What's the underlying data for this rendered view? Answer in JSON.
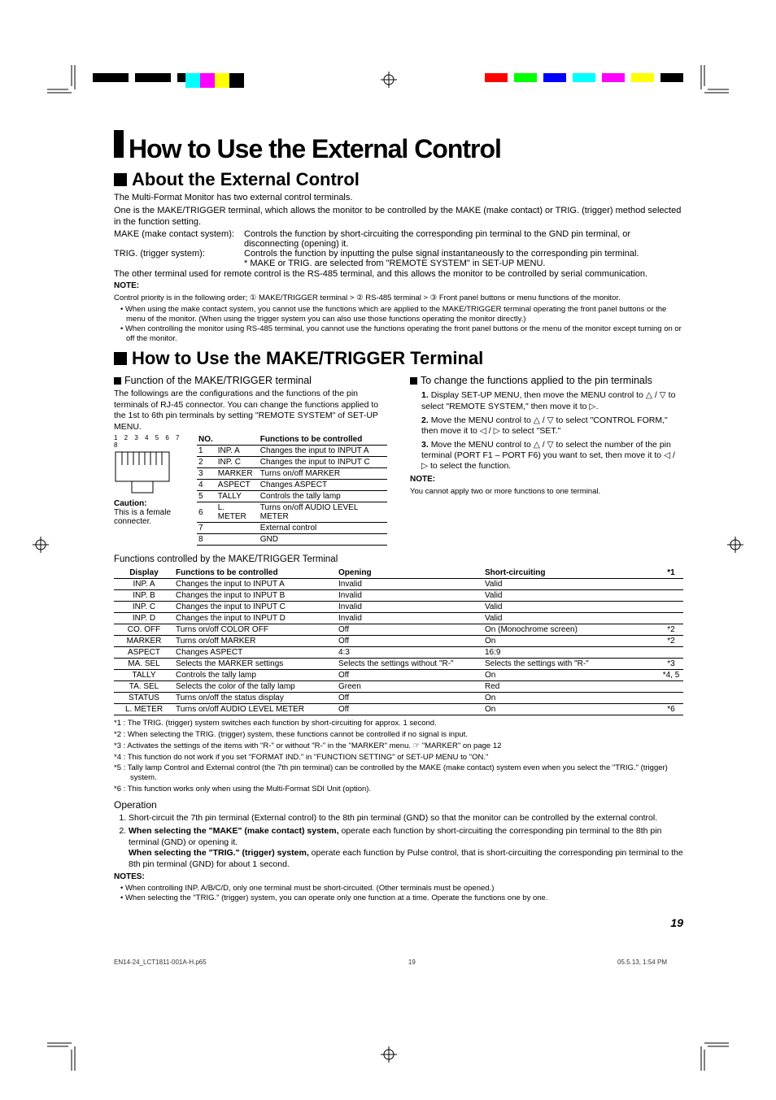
{
  "title": "How to Use the External Control",
  "about": {
    "heading": "About the External Control",
    "p1": "The Multi-Format Monitor has two external control terminals.",
    "p2": "One is the MAKE/TRIGGER terminal, which allows the monitor to be controlled by the MAKE (make contact) or TRIG. (trigger) method selected in the function setting.",
    "make_term": "MAKE (make contact system):",
    "make_desc": "Controls the function by short-circuiting the corresponding pin terminal to the GND pin terminal, or disconnecting (opening) it.",
    "trig_term": "TRIG. (trigger system):",
    "trig_desc1": "Controls the function by inputting the pulse signal instantaneously to the corresponding pin terminal.",
    "trig_desc2": "* MAKE or TRIG. are selected from \"REMOTE SYSTEM\" in SET-UP MENU.",
    "other_term": "The other terminal used for remote control is the RS-485 terminal, and this allows the monitor to be controlled by serial communication.",
    "note_label": "NOTE:",
    "note_intro": "Control priority is in the following order; ① MAKE/TRIGGER terminal > ② RS-485 terminal > ③ Front panel buttons or menu functions of the monitor.",
    "note_b1": "When using the make contact system, you cannot use the functions which are applied to the MAKE/TRIGGER terminal operating the front panel buttons or the menu of the monitor. (When using the trigger system you can also use those functions operating the monitor directly.)",
    "note_b2": "When controlling the monitor using RS-485 terminal, you cannot use the functions operating the front panel buttons or the menu of the monitor except turning on or off the monitor."
  },
  "maketrig": {
    "heading": "How to Use the MAKE/TRIGGER Terminal",
    "sub_left": "Function of the MAKE/TRIGGER terminal",
    "left_p": "The followings are the configurations and the functions of the pin terminals of RJ-45 connector. You can change the functions applied to the 1st to 6th pin terminals by setting \"REMOTE SYSTEM\" of SET-UP MENU.",
    "pin_nums": "1 2 3 4 5 6 7 8",
    "caution_label": "Caution:",
    "caution_text": "This is a female connecter.",
    "header_no": "NO.",
    "header_func": "Functions to be controlled",
    "rows": [
      {
        "n": "1",
        "name": "INP. A",
        "f": "Changes the input to INPUT A"
      },
      {
        "n": "2",
        "name": "INP. C",
        "f": "Changes the input to INPUT C"
      },
      {
        "n": "3",
        "name": "MARKER",
        "f": "Turns on/off MARKER"
      },
      {
        "n": "4",
        "name": "ASPECT",
        "f": "Changes ASPECT"
      },
      {
        "n": "5",
        "name": "TALLY",
        "f": "Controls the tally lamp"
      },
      {
        "n": "6",
        "name": "L. METER",
        "f": "Turns on/off AUDIO LEVEL METER"
      },
      {
        "n": "7",
        "name": "",
        "f": "External control"
      },
      {
        "n": "8",
        "name": "",
        "f": "GND"
      }
    ],
    "sub_right": "To change the functions applied to the pin terminals",
    "step1": "Display SET-UP MENU, then move the MENU control to △ / ▽ to select \"REMOTE SYSTEM,\" then move it to ▷.",
    "step2": "Move the MENU control to △ / ▽ to select \"CONTROL FORM,\" then move it to ◁ / ▷ to select \"SET.\"",
    "step3": "Move the MENU control to △ / ▽ to select the number of the pin terminal (PORT F1 – PORT F6) you want to set, then move it to ◁ / ▷ to select the function.",
    "right_note_label": "NOTE:",
    "right_note": "You cannot apply two or more functions to one terminal."
  },
  "func_header": "Functions controlled by the MAKE/TRIGGER Terminal",
  "func_cols": {
    "c1": "Display",
    "c2": "Functions to be controlled",
    "c3": "Opening",
    "c4": "Short-circuiting",
    "c5": "*1"
  },
  "func_rows": [
    {
      "d": "INP. A",
      "f": "Changes the input to INPUT A",
      "o": "Invalid",
      "s": "Valid",
      "n": ""
    },
    {
      "d": "INP. B",
      "f": "Changes the input to INPUT B",
      "o": "Invalid",
      "s": "Valid",
      "n": ""
    },
    {
      "d": "INP. C",
      "f": "Changes the input to INPUT C",
      "o": "Invalid",
      "s": "Valid",
      "n": ""
    },
    {
      "d": "INP. D",
      "f": "Changes the input to INPUT D",
      "o": "Invalid",
      "s": "Valid",
      "n": ""
    },
    {
      "d": "CO. OFF",
      "f": "Turns on/off COLOR OFF",
      "o": "Off",
      "s": "On (Monochrome screen)",
      "n": "*2"
    },
    {
      "d": "MARKER",
      "f": "Turns on/off MARKER",
      "o": "Off",
      "s": "On",
      "n": "*2"
    },
    {
      "d": "ASPECT",
      "f": "Changes ASPECT",
      "o": "4:3",
      "s": "16:9",
      "n": ""
    },
    {
      "d": "MA. SEL",
      "f": "Selects the MARKER settings",
      "o": "Selects the settings without \"R-\"",
      "s": "Selects the settings with \"R-\"",
      "n": "*3"
    },
    {
      "d": "TALLY",
      "f": "Controls the tally lamp",
      "o": "Off",
      "s": "On",
      "n": "*4, 5"
    },
    {
      "d": "TA. SEL",
      "f": "Selects the color of the tally lamp",
      "o": "Green",
      "s": "Red",
      "n": ""
    },
    {
      "d": "STATUS",
      "f": "Turns on/off the status display",
      "o": "Off",
      "s": "On",
      "n": ""
    },
    {
      "d": "L. METER",
      "f": "Turns on/off AUDIO LEVEL METER",
      "o": "Off",
      "s": "On",
      "n": "*6"
    }
  ],
  "footnotes": {
    "f1": "*1 : The TRIG. (trigger) system switches each function by short-circuiting for approx. 1 second.",
    "f2": "*2 : When selecting the TRIG. (trigger) system, these functions cannot be controlled if no signal is input.",
    "f3": "*3 : Activates the settings of the items with \"R-\" or without \"R-\" in the \"MARKER\" menu. ☞ \"MARKER\" on page 12",
    "f4": "*4 : This function do not work if you set \"FORMAT IND.\" in \"FUNCTION SETTING\" of SET-UP MENU to \"ON.\"",
    "f5": "*5 : Tally lamp Control and External control (the 7th pin terminal) can be controlled by the MAKE (make contact) system even when you select the \"TRIG.\" (trigger) system.",
    "f6": "*6 : This function works only when using the Multi-Format SDI Unit (option)."
  },
  "operation": {
    "header": "Operation",
    "o1": "Short-circuit the 7th pin terminal (External control) to the 8th pin terminal (GND) so that the monitor can be controlled by the external control.",
    "o2a_bold": "When selecting the \"MAKE\" (make contact) system,",
    "o2a": " operate each function by short-circuiting the corresponding pin terminal to the 8th pin terminal (GND) or opening it.",
    "o2b_bold": "When selecting the \"TRIG.\" (trigger) system,",
    "o2b": " operate each function by Pulse control, that is short-circuiting the corresponding pin terminal to the 8th pin terminal (GND) for about 1 second.",
    "notes_label": "NOTES:",
    "n1": "When controlling INP. A/B/C/D, only one terminal must be short-circuited. (Other terminals must be opened.)",
    "n2": "When selecting the \"TRIG.\" (trigger) system, you can operate only one function at a time. Operate the functions one by one."
  },
  "pagenum": "19",
  "footer": {
    "left": "EN14-24_LCT1811-001A-H.p65",
    "mid": "19",
    "right": "05.5.13, 1:54 PM"
  }
}
